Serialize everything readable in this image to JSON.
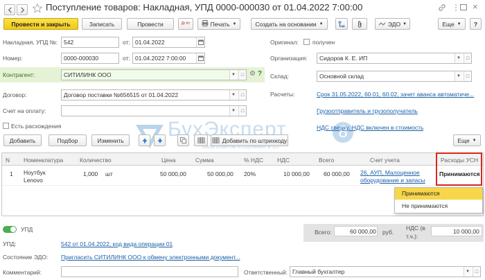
{
  "window": {
    "title": "Поступление товаров: Накладная, УПД 0000-000030 от 01.04.2022 7:00:00"
  },
  "toolbar": {
    "post_close": "Провести и закрыть",
    "save": "Записать",
    "post": "Провести",
    "dt_kt": "Дт Кт",
    "print": "Печать",
    "create_based": "Создать на основании",
    "edo": "ЭДО",
    "more": "Еще",
    "help": "?"
  },
  "header": {
    "invoice_label": "Накладная, УПД №:",
    "invoice_number": "542",
    "from_label": "от:",
    "invoice_date": "01.04.2022",
    "number_label": "Номер:",
    "number": "0000-000030",
    "number_from_label": "от:",
    "number_date": "01.04.2022  7:00:00",
    "original_label": "Оригинал:",
    "received_label": "получен",
    "org_label": "Организация:",
    "org_value": "Сидоров К. Е. ИП",
    "contractor_label": "Контрагент:",
    "contractor_value": "СИТИЛИНК ООО",
    "warehouse_label": "Склад:",
    "warehouse_value": "Основной склад",
    "contract_label": "Договор:",
    "contract_value": "Договор поставки №656515 от 01.04.2022",
    "settlements_label": "Расчеты:",
    "settlements_link": "Срок 31.05.2022, 60.01, 60.02, зачет аванса автоматиче...",
    "payment_label": "Счет на оплату:",
    "shipper_link": "Грузоотправитель и грузополучатель",
    "vat_link": "НДС сверху. НДС включен в стоимость",
    "discrepancies_label": "Есть расхождения"
  },
  "table_toolbar": {
    "add": "Добавить",
    "select": "Подбор",
    "change": "Изменить",
    "barcode": "Добавить по штрихкоду",
    "more": "Еще"
  },
  "watermark": {
    "brand": "БухЭксперт",
    "digit": "8",
    "tagline": "База ответов и обучения в 1С"
  },
  "table": {
    "headers": {
      "n": "N",
      "item": "Номенклатура",
      "qty": "Количество",
      "price": "Цена",
      "sum": "Сумма",
      "vat_pct": "% НДС",
      "vat": "НДС",
      "total": "Всего",
      "account": "Счет учета",
      "usn": "Расходы УСН"
    },
    "row": {
      "n": "1",
      "item_line1": "Ноутбук",
      "item_line2": "Lenovo",
      "qty": "1,000",
      "unit": "шт",
      "price": "50 000,00",
      "sum": "50 000,00",
      "vat_pct": "20%",
      "vat": "10 000,00",
      "total": "60 000,00",
      "account_line1": "26, АУП, Малоценное",
      "account_line2": "оборудование и запасы",
      "usn": "Принимаются"
    }
  },
  "dropdown": {
    "options": [
      "Принимаются",
      "Не принимаются"
    ],
    "selected": "Принимаются"
  },
  "footer": {
    "upd_toggle_label": "УПД",
    "totals_label": "Всего:",
    "totals_value": "60 000,00",
    "currency": "руб.",
    "vat_label_1": "НДС (в",
    "vat_label_2": "т.ч.):",
    "vat_value": "10 000,00",
    "upd_label": "УПД:",
    "upd_link": "542 от 01.04.2022, код вида операции 01",
    "edo_label": "Состояние ЭДО:",
    "edo_link": "Пригласить СИТИЛИНК ООО к обмену электронными документ...",
    "comment_label": "Комментарий:",
    "responsible_label": "Ответственный:",
    "responsible_value": "Главный бухгалтер"
  },
  "colors": {
    "accent_yellow": "#f1c919",
    "highlight_red": "#d9261c",
    "link_blue": "#1a5fa8",
    "toggle_green": "#4caf50",
    "selected_option": "#f7d64a"
  }
}
